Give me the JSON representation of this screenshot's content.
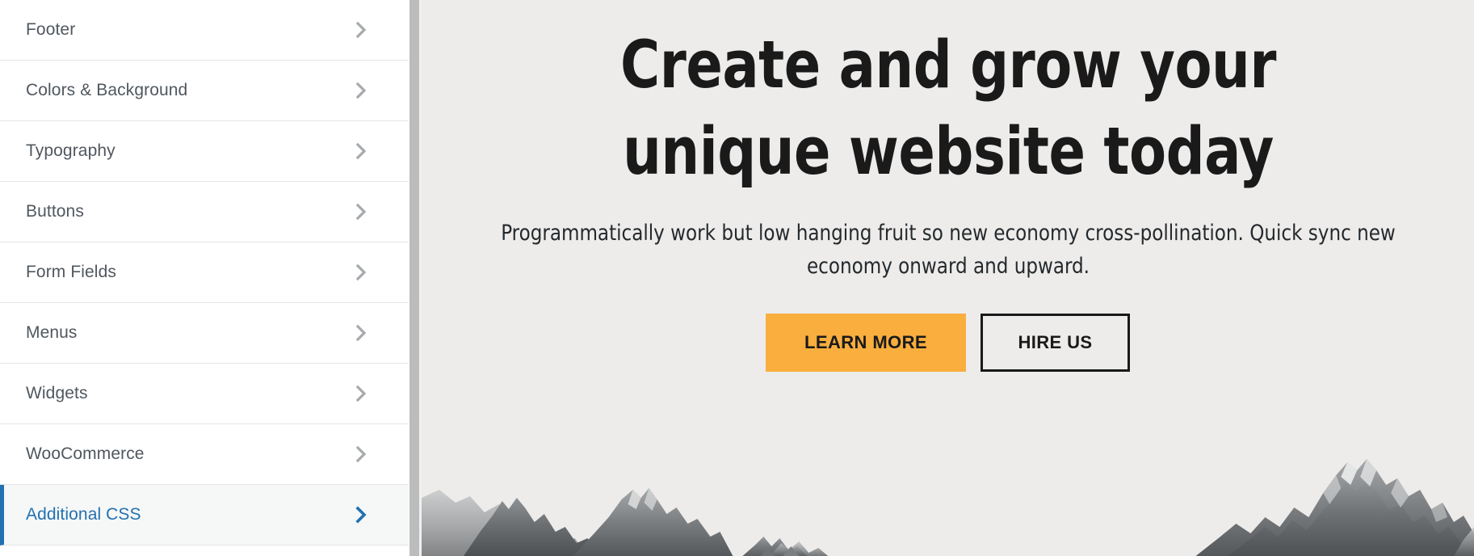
{
  "sidebar": {
    "name": "customizer-panel",
    "items": [
      {
        "label": "Footer",
        "icon": "chevron-right-icon",
        "active": false
      },
      {
        "label": "Colors & Background",
        "icon": "chevron-right-icon",
        "active": false
      },
      {
        "label": "Typography",
        "icon": "chevron-right-icon",
        "active": false
      },
      {
        "label": "Buttons",
        "icon": "chevron-right-icon",
        "active": false
      },
      {
        "label": "Form Fields",
        "icon": "chevron-right-icon",
        "active": false
      },
      {
        "label": "Menus",
        "icon": "chevron-right-icon",
        "active": false
      },
      {
        "label": "Widgets",
        "icon": "chevron-right-icon",
        "active": false
      },
      {
        "label": "WooCommerce",
        "icon": "chevron-right-icon",
        "active": false
      },
      {
        "label": "Additional CSS",
        "icon": "chevron-right-icon",
        "active": true
      }
    ],
    "colors": {
      "text": "#50575e",
      "active_text": "#2271b1",
      "active_bg": "#f6f7f7",
      "active_border": "#2271b1",
      "divider": "#e5e5e5",
      "chevron": "#a7aaad"
    }
  },
  "scrollbar": {
    "name": "sidebar-scrollbar",
    "thumb_color": "#bcbcbc",
    "track_color": "#f0f0f1"
  },
  "preview": {
    "hero": {
      "title": "Create and grow your unique website today",
      "subtitle": "Programmatically work but low hanging fruit so new economy cross-pollination. Quick sync new economy onward and upward.",
      "background_color": "#edecea",
      "buttons": [
        {
          "label": "Learn More",
          "style": "primary",
          "bg": "#f9ae3e",
          "text_color": "#1a1a1a"
        },
        {
          "label": "Hire Us",
          "style": "outline",
          "bg": "transparent",
          "text_color": "#1a1a1a",
          "border_color": "#18191a"
        }
      ],
      "image": "mountain-range-grayscale"
    }
  }
}
